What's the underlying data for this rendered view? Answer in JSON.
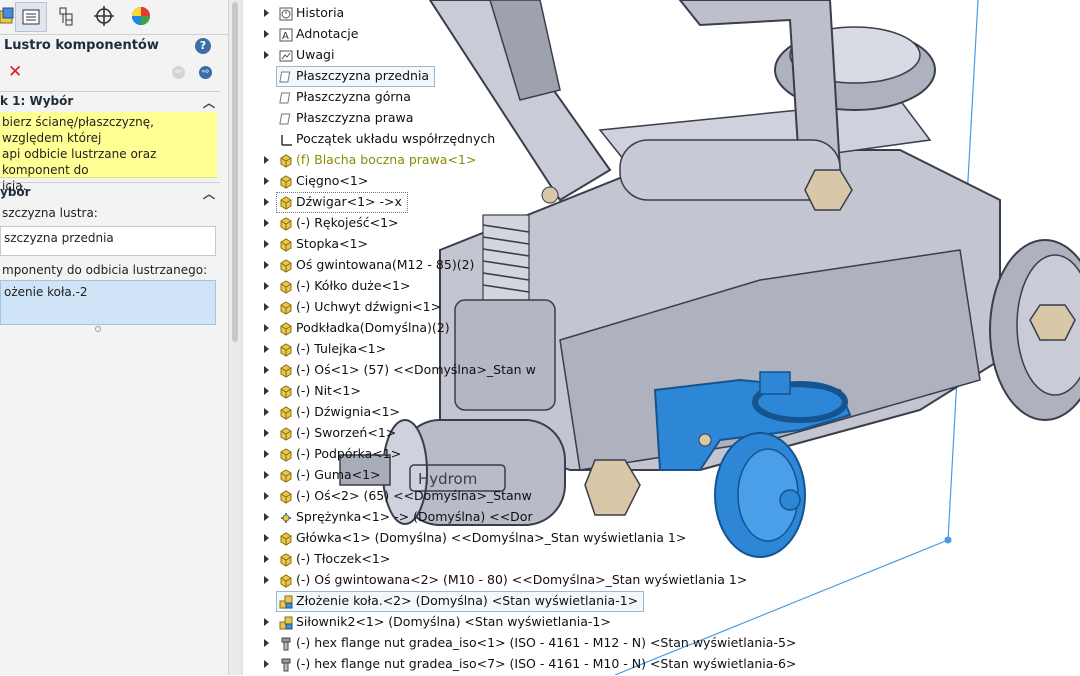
{
  "property_manager": {
    "title": "Lustro komponentów",
    "help": "?",
    "close": "✕",
    "nav_back": "⇦",
    "nav_forward": "⇨",
    "section1": {
      "title": "k 1: Wybór",
      "chevron": "︿",
      "message_line1": "bierz ścianę/płaszczyznę, względem której",
      "message_line2": "api odbicie lustrzane oraz komponent do",
      "message_line3": "icia."
    },
    "section2": {
      "title": "ybór",
      "chevron": "︿",
      "mirror_plane_label": "szczyzna lustra:",
      "mirror_plane_value": "szczyzna przednia",
      "components_label": "mponenty do odbicia lustrzanego:",
      "components_value": "ożenie koła.-2"
    },
    "tabs": [
      "featuremanager-icon",
      "propertymanager-icon",
      "configurationmanager-icon",
      "dimxpert-icon",
      "display-manager-icon"
    ]
  },
  "tree": {
    "items": [
      {
        "label": "Historia",
        "icon": "history-icon",
        "arrow": true
      },
      {
        "label": "Adnotacje",
        "icon": "annotations-icon",
        "arrow": true
      },
      {
        "label": "Uwagi",
        "icon": "notes-icon",
        "arrow": true
      },
      {
        "label": "Płaszczyzna przednia",
        "icon": "plane-icon",
        "arrow": false,
        "highlight": "selected"
      },
      {
        "label": "Płaszczyzna górna",
        "icon": "plane-icon",
        "arrow": false
      },
      {
        "label": "Płaszczyzna prawa",
        "icon": "plane-icon",
        "arrow": false
      },
      {
        "label": "Początek układu współrzędnych",
        "icon": "origin-icon",
        "arrow": false
      },
      {
        "label": "(f) Blacha boczna prawa<1>",
        "icon": "part-icon",
        "arrow": true,
        "color": "olive"
      },
      {
        "label": "Cięgno<1>",
        "icon": "part-icon",
        "arrow": true
      },
      {
        "label": "Dźwigar<1> ->x",
        "icon": "part-icon",
        "arrow": true,
        "highlight": "dotted"
      },
      {
        "label": "(-) Rękojeść<1>",
        "icon": "part-icon",
        "arrow": true
      },
      {
        "label": "Stopka<1>",
        "icon": "part-icon",
        "arrow": true
      },
      {
        "label": "Oś gwintowana(M12 - 85)(2)",
        "icon": "part-icon",
        "arrow": true
      },
      {
        "label": "(-) Kółko duże<1>",
        "icon": "part-icon",
        "arrow": true
      },
      {
        "label": "(-) Uchwyt dźwigni<1>",
        "icon": "part-icon",
        "arrow": true
      },
      {
        "label": "Podkładka(Domyślna)(2)",
        "icon": "part-icon",
        "arrow": true
      },
      {
        "label": "(-) Tulejka<1>",
        "icon": "part-icon",
        "arrow": true
      },
      {
        "label": "(-) Oś<1> (57) <<Domyślna>_Stan w",
        "icon": "part-icon",
        "arrow": true
      },
      {
        "label": "(-) Nit<1>",
        "icon": "part-icon",
        "arrow": true
      },
      {
        "label": "(-) Dźwignia<1>",
        "icon": "part-icon",
        "arrow": true
      },
      {
        "label": "(-) Sworzeń<1>",
        "icon": "part-icon",
        "arrow": true
      },
      {
        "label": "(-) Podpórka<1>",
        "icon": "part-icon",
        "arrow": true
      },
      {
        "label": "(-) Guma<1>",
        "icon": "part-icon",
        "arrow": true
      },
      {
        "label": "(-) Oś<2> (65) <<Domyślna>_Stanw",
        "icon": "part-icon",
        "arrow": true
      },
      {
        "label": "Sprężynka<1> -> (Domyślna) <<Dor",
        "icon": "spring-icon",
        "arrow": true
      },
      {
        "label": "Główka<1> (Domyślna) <<Domyślna>_Stan wyświetlania 1>",
        "icon": "part-icon",
        "arrow": true
      },
      {
        "label": "(-) Tłoczek<1>",
        "icon": "part-icon",
        "arrow": true
      },
      {
        "label": "(-) Oś gwintowana<2> (M10 - 80) <<Domyślna>_Stan wyświetlania 1>",
        "icon": "part-icon",
        "arrow": true
      },
      {
        "label": "Złożenie koła.<2> (Domyślna) <Stan wyświetlania-1>",
        "icon": "subassembly-icon",
        "arrow": false,
        "highlight": "selected"
      },
      {
        "label": "Siłownik2<1> (Domyślna) <Stan wyświetlania-1>",
        "icon": "subassembly-icon",
        "arrow": true
      },
      {
        "label": "(-) hex flange nut gradea_iso<1> (ISO - 4161 - M12 - N) <Stan wyświetlania-5>",
        "icon": "nut-icon",
        "arrow": true
      },
      {
        "label": "(-) hex flange nut gradea_iso<7> (ISO - 4161 - M10 - N) <Stan wyświetlania-6>",
        "icon": "nut-icon",
        "arrow": true
      }
    ]
  },
  "model": {
    "label_on_cylinder": "Hydrom",
    "colors": {
      "part_metal": "#b9bcc8",
      "part_edge": "#3a3d4a",
      "wheel_assembly": "#2e86d6",
      "bounding_box": "#4a9be0",
      "olive_text": "#8c8c00",
      "message_bg": "#ffff93"
    }
  }
}
